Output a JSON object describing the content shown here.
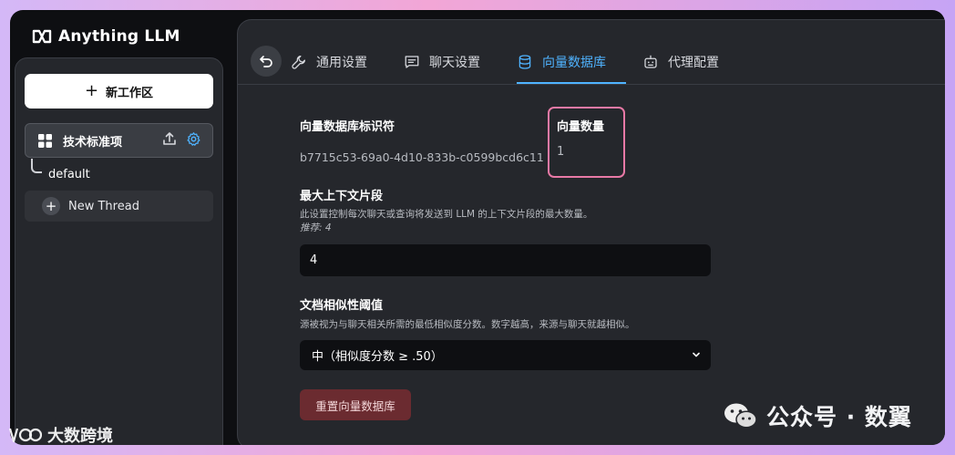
{
  "app": {
    "brand": "Anything LLM"
  },
  "sidebar": {
    "new_workspace": "新工作区",
    "workspace": {
      "name": "技术标准项"
    },
    "thread_default": "default",
    "new_thread": "New Thread"
  },
  "tabs": [
    {
      "label": "通用设置",
      "icon": "wrench-icon",
      "active": false
    },
    {
      "label": "聊天设置",
      "icon": "chat-icon",
      "active": false
    },
    {
      "label": "向量数据库",
      "icon": "database-icon",
      "active": true
    },
    {
      "label": "代理配置",
      "icon": "robot-icon",
      "active": false
    }
  ],
  "vector": {
    "identifier_label": "向量数据库标识符",
    "identifier_value": "b7715c53-69a0-4d10-833b-c0599bcd6c11",
    "count_label": "向量数量",
    "count_value": "1"
  },
  "context": {
    "label": "最大上下文片段",
    "description": "此设置控制每次聊天或查询将发送到 LLM 的上下文片段的最大数量。",
    "recommend": "推荐: 4",
    "value": "4"
  },
  "similarity": {
    "label": "文档相似性阈值",
    "description": "源被视为与聊天相关所需的最低相似度分数。数字越高，来源与聊天就越相似。",
    "selected": "中（相似度分数 ≥ .50）"
  },
  "reset_button": "重置向量数据库",
  "watermarks": {
    "right": "公众号 · 数翼",
    "left": "大数跨境"
  },
  "colors": {
    "accent": "#4fb3ff",
    "highlight_box": "#e879a6",
    "danger": "#6b2b30"
  }
}
